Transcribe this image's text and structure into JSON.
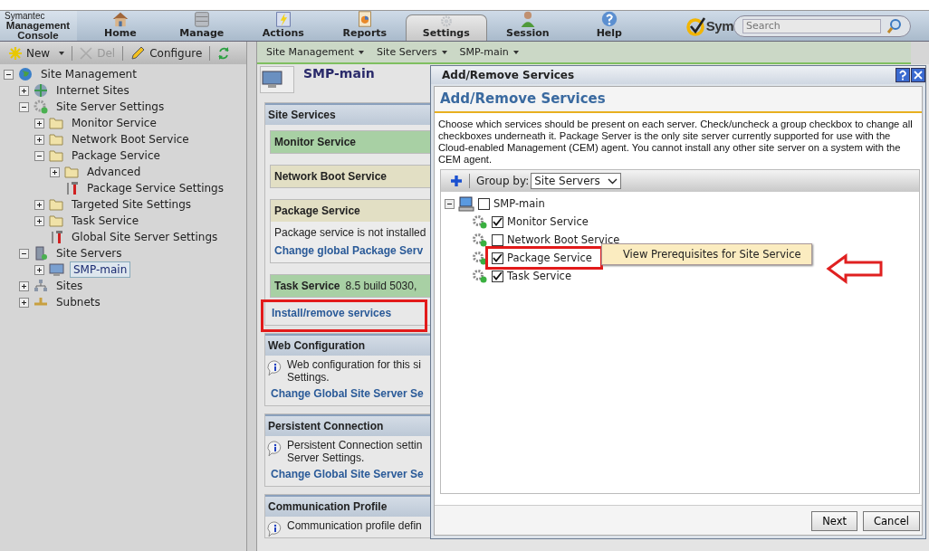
{
  "brand": {
    "vendor": "Symantec",
    "product": "Management Console",
    "logo_text": "Sym"
  },
  "nav": [
    {
      "label": "Home",
      "kind": "home",
      "selected": false
    },
    {
      "label": "Manage",
      "kind": "manage",
      "selected": false
    },
    {
      "label": "Actions",
      "kind": "actions",
      "selected": false
    },
    {
      "label": "Reports",
      "kind": "reports",
      "selected": false
    },
    {
      "label": "Settings",
      "kind": "settings",
      "selected": true
    },
    {
      "label": "Session",
      "kind": "session",
      "selected": false
    },
    {
      "label": "Help",
      "kind": "help",
      "selected": false
    }
  ],
  "search": {
    "placeholder": "Search"
  },
  "toolbar": [
    {
      "kind": "new",
      "label": "New",
      "disabled": false
    },
    {
      "kind": "delete",
      "label": "Del",
      "disabled": true
    },
    {
      "kind": "configure",
      "label": "Configure",
      "disabled": false
    },
    {
      "kind": "refresh",
      "disabled": false
    }
  ],
  "breadcrumb": [
    "Site Management",
    "Site Servers",
    "SMP-main"
  ],
  "tree": [
    {
      "label": "Site Management",
      "kind": "globe",
      "expanded": true,
      "selected": false,
      "children": [
        {
          "label": "Internet Sites",
          "kind": "internet",
          "expanded": false,
          "selected": false
        },
        {
          "label": "Site Server Settings",
          "kind": "gear",
          "expanded": true,
          "selected": false,
          "children": [
            {
              "label": "Monitor Service",
              "kind": "folder",
              "expanded": false,
              "selected": false
            },
            {
              "label": "Network Boot Service",
              "kind": "folder",
              "expanded": false,
              "selected": false
            },
            {
              "label": "Package Service",
              "kind": "folder",
              "expanded": true,
              "selected": false,
              "children": [
                {
                  "label": "Advanced",
                  "kind": "folder",
                  "expanded": false,
                  "selected": false
                },
                {
                  "label": "Package Service Settings",
                  "kind": "tools",
                  "selected": false
                }
              ]
            },
            {
              "label": "Targeted Site Settings",
              "kind": "folder",
              "expanded": false,
              "selected": false
            },
            {
              "label": "Task Service",
              "kind": "folder",
              "expanded": false,
              "selected": false
            },
            {
              "label": "Global Site Server Settings",
              "kind": "tools",
              "selected": false
            }
          ]
        },
        {
          "label": "Site Servers",
          "kind": "server",
          "expanded": true,
          "selected": false,
          "children": [
            {
              "label": "SMP-main",
              "kind": "computer",
              "expanded": false,
              "selected": true
            }
          ]
        },
        {
          "label": "Sites",
          "kind": "sites",
          "expanded": false,
          "selected": false
        },
        {
          "label": "Subnets",
          "kind": "subnets",
          "expanded": false,
          "selected": false
        }
      ]
    }
  ],
  "page": {
    "title": "SMP-main",
    "site_services": {
      "title": "Site Services",
      "services": [
        {
          "name": "Monitor Service",
          "color": "#a8d0a4"
        },
        {
          "name": "Network Boot Service",
          "color": "#e2dfc4"
        },
        {
          "name": "Package Service",
          "color": "#e2dfc4",
          "note": "Package service is not installed",
          "link": "Change global Package Serv"
        },
        {
          "name": "Task Service",
          "color": "#a8d0a4",
          "version": "8.5 build 5030,"
        }
      ],
      "link": "Install/remove services"
    },
    "sections": [
      {
        "title": "Web Configuration",
        "text": "Web configuration for this si Settings.",
        "link": "Change Global Site Server Se"
      },
      {
        "title": "Persistent Connection",
        "text": "Persistent Connection settin Server Settings.",
        "link": "Change Global Site Server Se"
      },
      {
        "title": "Communication Profile",
        "text": "Communication profile defin"
      }
    ]
  },
  "dialog": {
    "window_title": "Add/Remove Services",
    "heading": "Add/Remove Services",
    "description": "Choose which services should be present on each server. Check/uncheck a group checkbox to change all checkboxes underneath it. Package Server is the only site server currently supported for use with the Cloud-enabled Management (CEM) agent. You cannot install any other site server on a system with the CEM agent.",
    "group_by_label": "Group by:",
    "group_by_value": "Site Servers",
    "tree": [
      {
        "label": "SMP-main",
        "expanded": true,
        "checked": false,
        "children": [
          {
            "label": "Monitor Service",
            "checked": true
          },
          {
            "label": "Network Boot Service",
            "checked": false
          },
          {
            "label": "Package Service",
            "checked": true
          },
          {
            "label": "Task Service",
            "checked": true
          }
        ]
      }
    ],
    "context_menu": [
      "View Prerequisites for Site Service"
    ],
    "buttons": [
      "Next",
      "Cancel"
    ]
  }
}
